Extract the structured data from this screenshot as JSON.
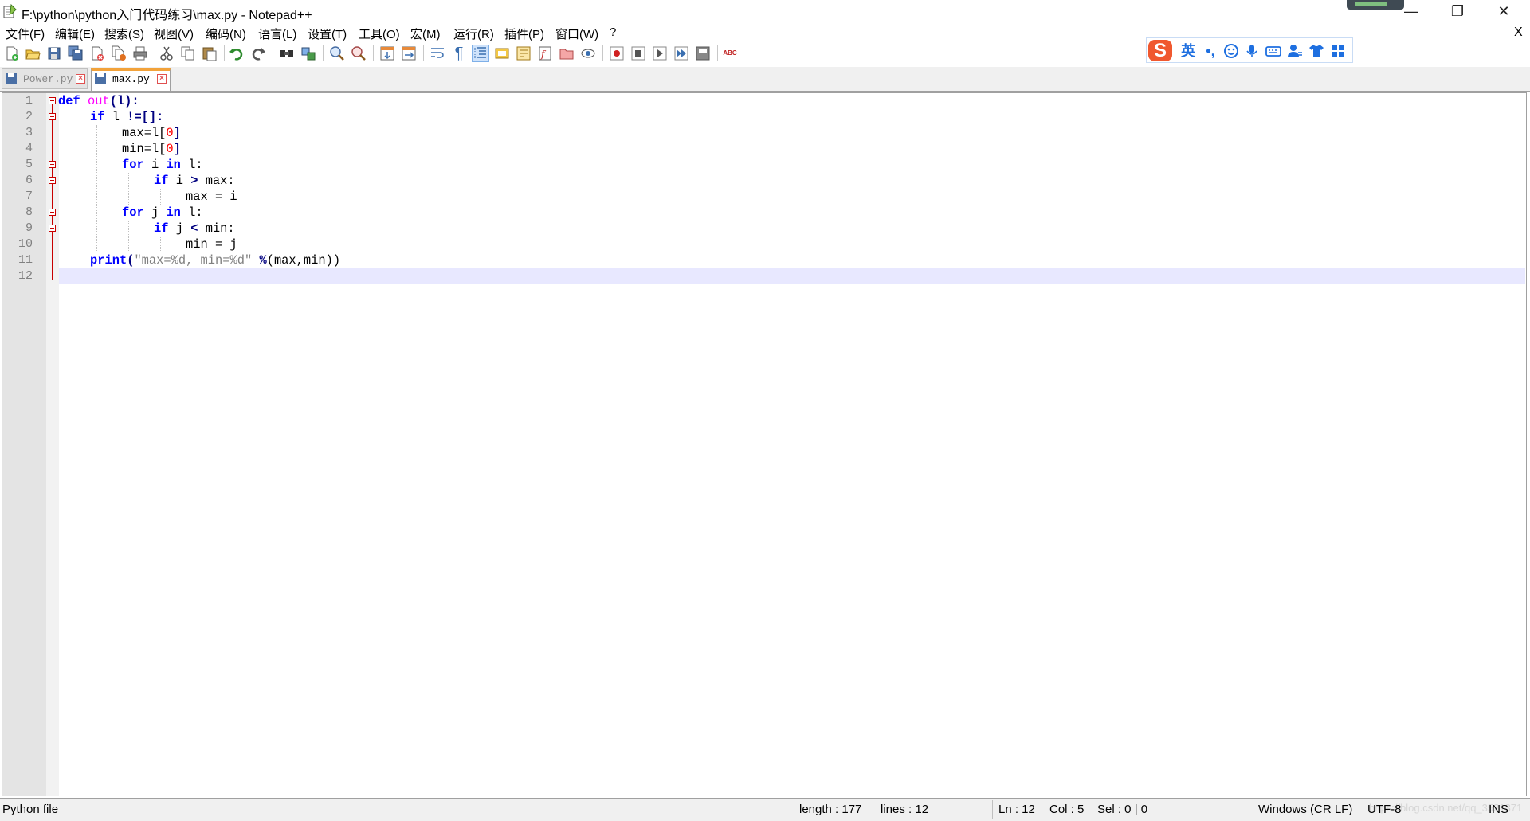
{
  "window": {
    "title": "F:\\python\\python入门代码练习\\max.py - Notepad++",
    "minimize_glyph": "—",
    "maximize_glyph": "❐",
    "close_glyph": "✕"
  },
  "menu": {
    "items": [
      "文件(F)",
      "编辑(E)",
      "搜索(S)",
      "视图(V)",
      "编码(N)",
      "语言(L)",
      "设置(T)",
      "工具(O)",
      "宏(M)",
      "运行(R)",
      "插件(P)",
      "窗口(W)",
      "?"
    ],
    "close_doc": "X"
  },
  "toolbar": {
    "icons": [
      "new-file-icon",
      "open-file-icon",
      "save-icon",
      "save-all-icon",
      "close-icon",
      "close-all-icon",
      "print-icon",
      "cut-icon",
      "copy-icon",
      "paste-icon",
      "undo-icon",
      "redo-icon",
      "find-icon",
      "replace-icon",
      "zoom-in-icon",
      "zoom-out-icon",
      "sync-vertical-icon",
      "sync-horizontal-icon",
      "word-wrap-icon",
      "show-all-chars-icon",
      "indent-guide-icon",
      "user-language-icon",
      "doc-map-icon",
      "function-list-icon",
      "folder-workspace-icon",
      "monitoring-icon",
      "record-macro-icon",
      "stop-macro-icon",
      "play-macro-icon",
      "run-macro-multiple-icon",
      "save-macro-icon",
      "spell-check-icon"
    ],
    "spellcheck_text": "ABC"
  },
  "ime": {
    "logo": "S",
    "mode": "英",
    "punct": "•,",
    "icons": [
      "emoji-icon",
      "mic-icon",
      "keyboard-icon",
      "user-icon",
      "skin-icon",
      "apps-icon"
    ]
  },
  "tabs": [
    {
      "label": "Power.py",
      "active": false
    },
    {
      "label": "max.py",
      "active": true
    }
  ],
  "editor": {
    "line_numbers": [
      "1",
      "2",
      "3",
      "4",
      "5",
      "6",
      "7",
      "8",
      "9",
      "10",
      "11",
      "12"
    ],
    "code": {
      "l1_def": "def",
      "l1_name": "out",
      "l1_rest": "(l):",
      "l2_if": "if",
      "l2_rest": " l ",
      "l2_op": "!=[]:",
      "l3_a": "max=l[",
      "l3_n": "0",
      "l3_b": "]",
      "l4_a": "min=l[",
      "l4_n": "0",
      "l4_b": "]",
      "l5_for": "for",
      "l5_mid": " i ",
      "l5_in": "in",
      "l5_rest": " l:",
      "l6_if": "if",
      "l6_rest": " i ",
      "l6_op": ">",
      "l6_end": " max:",
      "l7": "max = i",
      "l8_for": "for",
      "l8_mid": " j ",
      "l8_in": "in",
      "l8_rest": " l:",
      "l9_if": "if",
      "l9_rest": " j ",
      "l9_op": "<",
      "l9_end": " min:",
      "l10": "min = j",
      "l11_print": "print",
      "l11_paren": "(",
      "l11_str": "\"max=%d, min=%d\"",
      "l11_op": " %",
      "l11_rest": "(max,min))"
    }
  },
  "status": {
    "file_type": "Python file",
    "length": "length : 177",
    "lines": "lines : 12",
    "ln": "Ln : 12",
    "col": "Col : 5",
    "sel": "Sel : 0 | 0",
    "eol": "Windows (CR LF)",
    "encoding": "UTF-8",
    "mode": "INS",
    "watermark": "https://blog.csdn.net/qq_3521371"
  },
  "colors": {
    "keyword": "#0000ff",
    "function_name": "#ff00ff",
    "number": "#ff0000",
    "string": "#808080",
    "caret_line": "#e8e8ff",
    "active_tab_accent": "#f2a23a"
  }
}
